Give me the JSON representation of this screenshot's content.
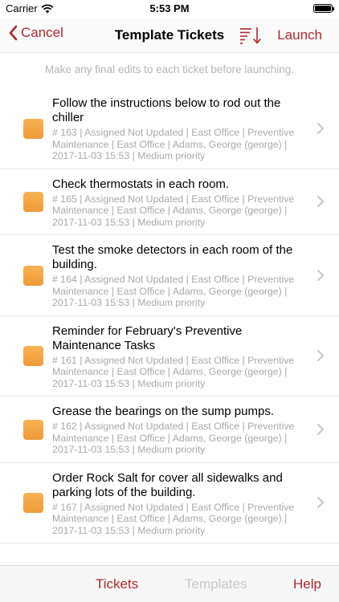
{
  "status_bar": {
    "carrier": "Carrier",
    "time": "5:53 PM"
  },
  "nav": {
    "cancel_label": "Cancel",
    "title": "Template Tickets",
    "launch_label": "Launch",
    "accent_color": "#b0282e"
  },
  "hint": "Make any final edits to each ticket before launching.",
  "tickets": [
    {
      "title": "Follow the instructions below to rod out the chiller",
      "meta": "# 163 | Assigned Not Updated | East Office | Preventive Maintenance | East Office | Adams, George (george) | 2017-11-03 15:53 | Medium priority"
    },
    {
      "title": "Check thermostats in each room.",
      "meta": "# 165 | Assigned Not Updated | East Office | Preventive Maintenance | East Office | Adams, George (george) | 2017-11-03 15:53 | Medium priority"
    },
    {
      "title": "Test the smoke detectors in each room of the building.",
      "meta": "# 164 | Assigned Not Updated | East Office | Preventive Maintenance | East Office | Adams, George (george) | 2017-11-03 15:53 | Medium priority"
    },
    {
      "title": "Reminder for February's Preventive Maintenance Tasks",
      "meta": "# 161 | Assigned Not Updated | East Office | Preventive Maintenance | East Office | Adams, George (george) | 2017-11-03 15:53 | Medium priority"
    },
    {
      "title": "Grease the bearings on the sump pumps.",
      "meta": "# 162 | Assigned Not Updated | East Office | Preventive Maintenance | East Office | Adams, George (george) | 2017-11-03 15:53 | Medium priority"
    },
    {
      "title": "Order Rock Salt for cover all sidewalks and parking lots of the building.",
      "meta": "# 167 | Assigned Not Updated | East Office | Preventive Maintenance | East Office | Adams, George (george) | 2017-11-03 15:53 | Medium priority"
    }
  ],
  "tabs": {
    "tickets": "Tickets",
    "templates": "Templates",
    "help": "Help"
  }
}
